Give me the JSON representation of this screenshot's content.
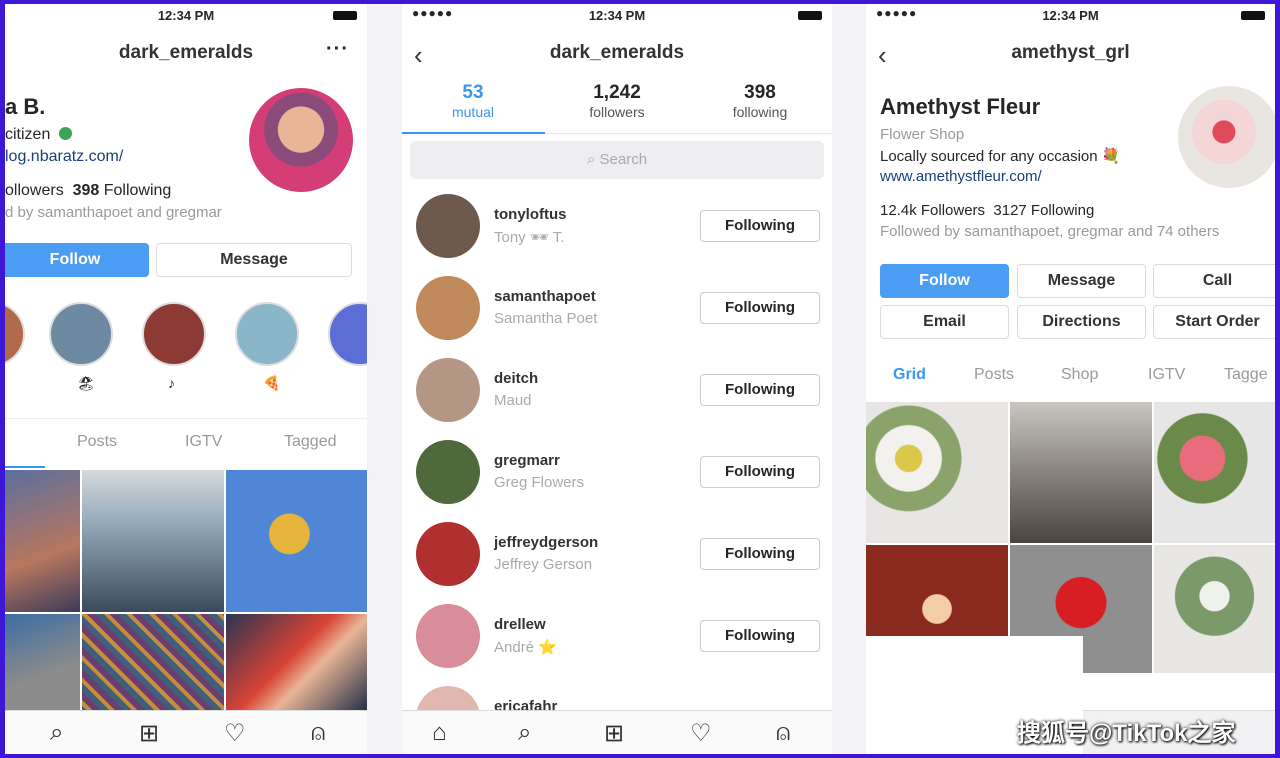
{
  "status": {
    "time": "12:34 PM",
    "signal": "●●●●●"
  },
  "left": {
    "username": "dark_emeralds",
    "more": "···",
    "name": "a B.",
    "bio1": "citizen",
    "link": "log.nbaratz.com/",
    "followers_count": "ollowers",
    "following_count": "398",
    "following_label": "Following",
    "followed_by": "d by samanthapoet and gregmar",
    "follow": "Follow",
    "message": "Message",
    "tabs": [
      "Posts",
      "IGTV",
      "Tagged"
    ]
  },
  "middle": {
    "username": "dark_emeralds",
    "stats": [
      {
        "num": "53",
        "label": "mutual"
      },
      {
        "num": "1,242",
        "label": "followers"
      },
      {
        "num": "398",
        "label": "following"
      }
    ],
    "search_placeholder": "Search",
    "search_icon": "search-icon",
    "rows": [
      {
        "handle": "tonyloftus",
        "name": "Tony 🕶 T.",
        "button": "Following",
        "color": "#6e5a4c"
      },
      {
        "handle": "samanthapoet",
        "name": "Samantha Poet",
        "button": "Following",
        "color": "#c08a5c"
      },
      {
        "handle": "deitch",
        "name": "Maud",
        "button": "Following",
        "color": "#b39684"
      },
      {
        "handle": "gregmarr",
        "name": "Greg Flowers",
        "button": "Following",
        "color": "#4f6a3a"
      },
      {
        "handle": "jeffreydgerson",
        "name": "Jeffrey Gerson",
        "button": "Following",
        "color": "#b02f2f"
      },
      {
        "handle": "drellew",
        "name": "André ⭐",
        "button": "Following",
        "color": "#d98c99"
      },
      {
        "handle": "ericafahr",
        "name": "",
        "button": "",
        "color": "#e0b8b0"
      }
    ]
  },
  "right": {
    "username": "amethyst_grl",
    "name": "Amethyst Fleur",
    "category": "Flower Shop",
    "bio": "Locally sourced for any occasion 💐",
    "link": "www.amethystfleur.com/",
    "followers": "12.4k Followers",
    "following": "3127 Following",
    "followed_by": "Followed by samanthapoet, gregmar and 74 others",
    "buttons": {
      "follow": "Follow",
      "message": "Message",
      "call": "Call",
      "email": "Email",
      "directions": "Directions",
      "start_order": "Start Order"
    },
    "tabs": [
      "Grid",
      "Posts",
      "Shop",
      "IGTV",
      "Tagge"
    ]
  },
  "watermark": "搜狐号@TikTok之家"
}
